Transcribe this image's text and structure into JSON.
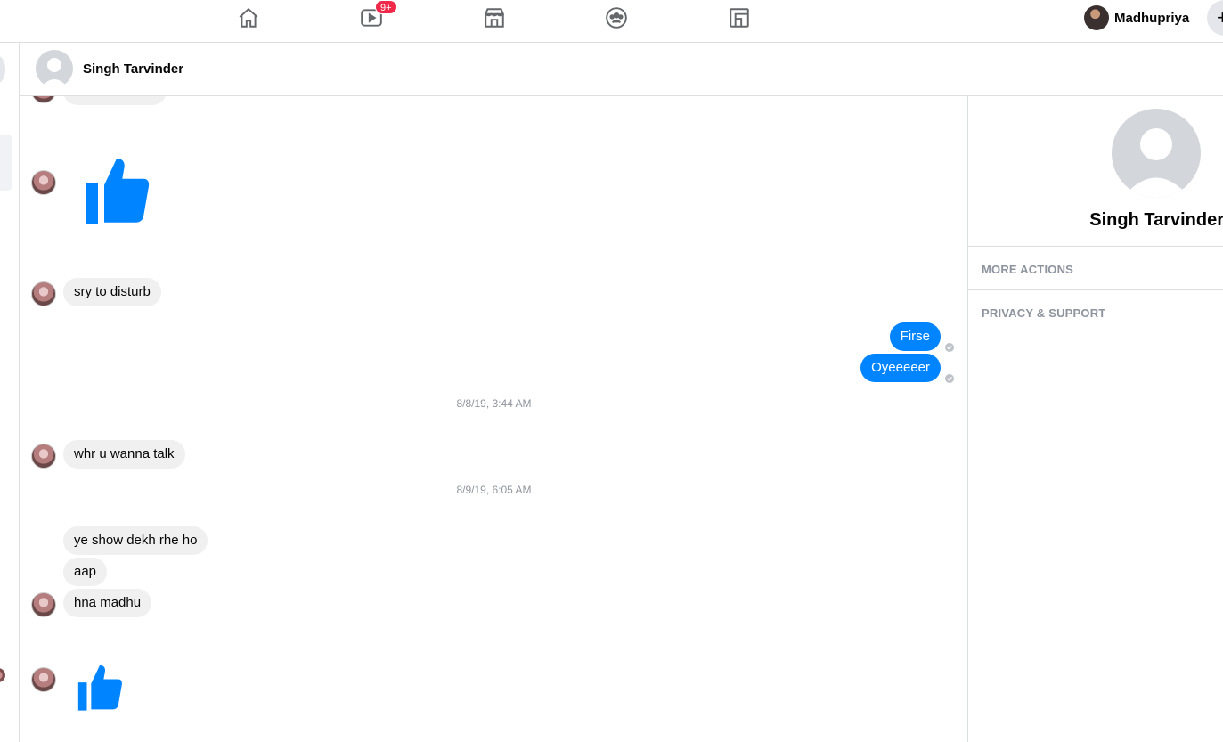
{
  "nav": {
    "icons": [
      "home-icon",
      "watch-icon",
      "marketplace-icon",
      "groups-icon",
      "gaming-icon"
    ],
    "watch_badge": "9+",
    "user_name": "Madhupriya"
  },
  "conversation": {
    "contact_name": "Singh Tarvinder"
  },
  "messages": {
    "m1": "sry to disturb",
    "m2": "Firse",
    "m3": "Oyeeeeer",
    "ts1": "8/8/19, 3:44 AM",
    "m4": "whr u wanna talk",
    "ts2": "8/9/19, 6:05 AM",
    "m5": "ye show dekh rhe ho",
    "m6": "aap",
    "m7": "hna madhu"
  },
  "info_panel": {
    "name": "Singh Tarvinder",
    "more_actions": "MORE ACTIONS",
    "privacy_support": "PRIVACY & SUPPORT"
  },
  "colors": {
    "accent": "#0084ff",
    "incoming_bubble": "#f1f0f0",
    "badge": "#f02849"
  }
}
